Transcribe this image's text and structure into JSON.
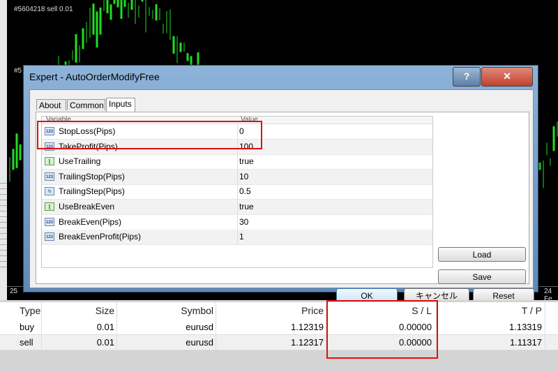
{
  "chart": {
    "top_label": "#5604218 sell 0.01",
    "side_label": "#5",
    "axis_left": "25",
    "axis_right": "24 Fe"
  },
  "dialog": {
    "title": "Expert - AutoOrderModifyFree",
    "help_label": "?",
    "close_label": "✕",
    "tabs": [
      {
        "label": "About",
        "active": false
      },
      {
        "label": "Common",
        "active": false
      },
      {
        "label": "Inputs",
        "active": true
      }
    ],
    "grid": {
      "header_variable": "Variable",
      "header_value": "Value",
      "rows": [
        {
          "icon": "123",
          "name": "StopLoss(Pips)",
          "value": "0"
        },
        {
          "icon": "123",
          "name": "TakeProfit(Pips)",
          "value": "100"
        },
        {
          "icon": "bool",
          "name": "UseTrailing",
          "value": "true"
        },
        {
          "icon": "123",
          "name": "TrailingStop(Pips)",
          "value": "10"
        },
        {
          "icon": "V2",
          "name": "TrailingStep(Pips)",
          "value": "0.5"
        },
        {
          "icon": "bool",
          "name": "UseBreakEven",
          "value": "true"
        },
        {
          "icon": "123",
          "name": "BreakEven(Pips)",
          "value": "30"
        },
        {
          "icon": "123",
          "name": "BreakEvenProfit(Pips)",
          "value": "1"
        }
      ]
    },
    "buttons": {
      "load": "Load",
      "save": "Save",
      "ok": "OK",
      "cancel": "キャンセル",
      "reset": "Reset"
    }
  },
  "terminal": {
    "headers": {
      "type": "Type",
      "size": "Size",
      "symbol": "Symbol",
      "price": "Price",
      "sl": "S / L",
      "tp": "T / P"
    },
    "rows": [
      {
        "type": "buy",
        "size": "0.01",
        "symbol": "eurusd",
        "price": "1.12319",
        "sl": "0.00000",
        "tp": "1.13319"
      },
      {
        "type": "sell",
        "size": "0.01",
        "symbol": "eurusd",
        "price": "1.12317",
        "sl": "0.00000",
        "tp": "1.11317"
      }
    ]
  },
  "colors": {
    "highlight": "#dd1111",
    "candle": "#22dd22"
  }
}
